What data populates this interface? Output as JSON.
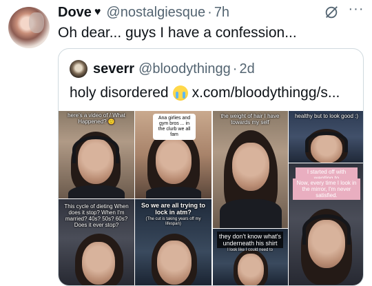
{
  "tweet": {
    "display_name": "Dove",
    "name_emoji": "♥",
    "handle": "@nostalgiesque",
    "separator": "·",
    "time": "7h",
    "text": "Oh dear... guys I have a confession...",
    "more_label": "···"
  },
  "quote": {
    "display_name": "severr",
    "handle": "@bloodythingg",
    "separator": "·",
    "time": "2d",
    "text_before": "holy disordered",
    "text_after": "x.com/bloodythingg/s..."
  },
  "media": {
    "captions": {
      "a1": "here's a video of / What Happened? 🙂",
      "a2": "Ana girlies and gym bros ... in the clurb we all fam",
      "a3": "This cycle of dieting When does it stop? When I'm married? 40s? 50s? 60s? Does it ever stop?",
      "a4": "So we are all trying to lock in atm?",
      "a5": "(The cut is taking years off my lifespan)",
      "b1": "the weight of hair I have towards my self",
      "b2": "healthy but to look good :)",
      "b3": "I started off with wanting to",
      "b4": "Now, every time I look in the mirror, I'm never satisfied.",
      "b5": "they don't know what's underneath his shirt",
      "b6": "I look like I could need to"
    }
  }
}
